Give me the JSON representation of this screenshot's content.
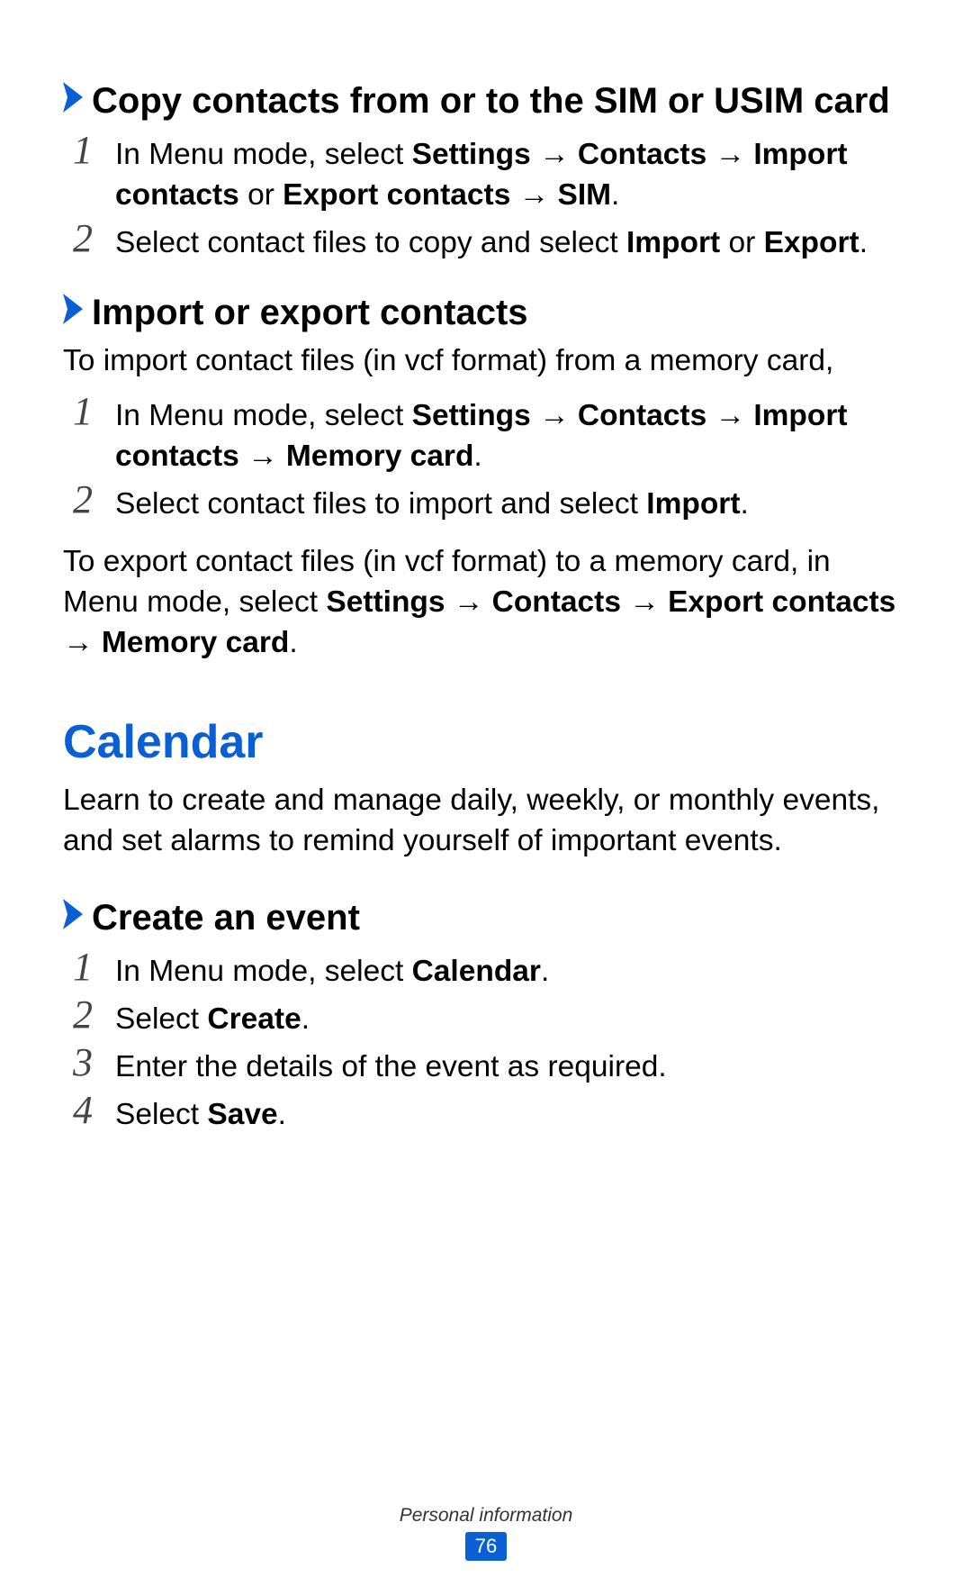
{
  "arrow": "→",
  "sections": {
    "copy": {
      "title": "Copy contacts from or to the SIM or USIM card",
      "steps": {
        "s1": {
          "num": "1",
          "t1": "In Menu mode, select ",
          "b1": "Settings",
          "b2": "Contacts",
          "b3": "Import contacts",
          "t2": " or ",
          "b4": "Export contacts",
          "b5": "SIM",
          "t3": "."
        },
        "s2": {
          "num": "2",
          "t1": "Select contact files to copy and select ",
          "b1": "Import",
          "t2": " or ",
          "b2": "Export",
          "t3": "."
        }
      }
    },
    "importexport": {
      "title": "Import or export contacts",
      "intro": "To import contact files (in vcf format) from a memory card,",
      "steps": {
        "s1": {
          "num": "1",
          "t1": "In Menu mode, select ",
          "b1": "Settings",
          "b2": "Contacts",
          "b3": "Import contacts",
          "b4": "Memory card",
          "t2": "."
        },
        "s2": {
          "num": "2",
          "t1": "Select contact files to import and select ",
          "b1": "Import",
          "t2": "."
        }
      },
      "export_para": {
        "t1": "To export contact files (in vcf format) to a memory card, in Menu mode, select ",
        "b1": "Settings",
        "b2": "Contacts",
        "b3": "Export contacts",
        "b4": "Memory card",
        "t2": "."
      }
    },
    "calendar": {
      "title": "Calendar",
      "intro": "Learn to create and manage daily, weekly, or monthly events, and set alarms to remind yourself of important events.",
      "create": {
        "title": "Create an event",
        "steps": {
          "s1": {
            "num": "1",
            "t1": "In Menu mode, select ",
            "b1": "Calendar",
            "t2": "."
          },
          "s2": {
            "num": "2",
            "t1": "Select ",
            "b1": "Create",
            "t2": "."
          },
          "s3": {
            "num": "3",
            "t1": "Enter the details of the event as required."
          },
          "s4": {
            "num": "4",
            "t1": "Select ",
            "b1": "Save",
            "t2": "."
          }
        }
      }
    }
  },
  "footer": {
    "section": "Personal information",
    "page": "76"
  }
}
